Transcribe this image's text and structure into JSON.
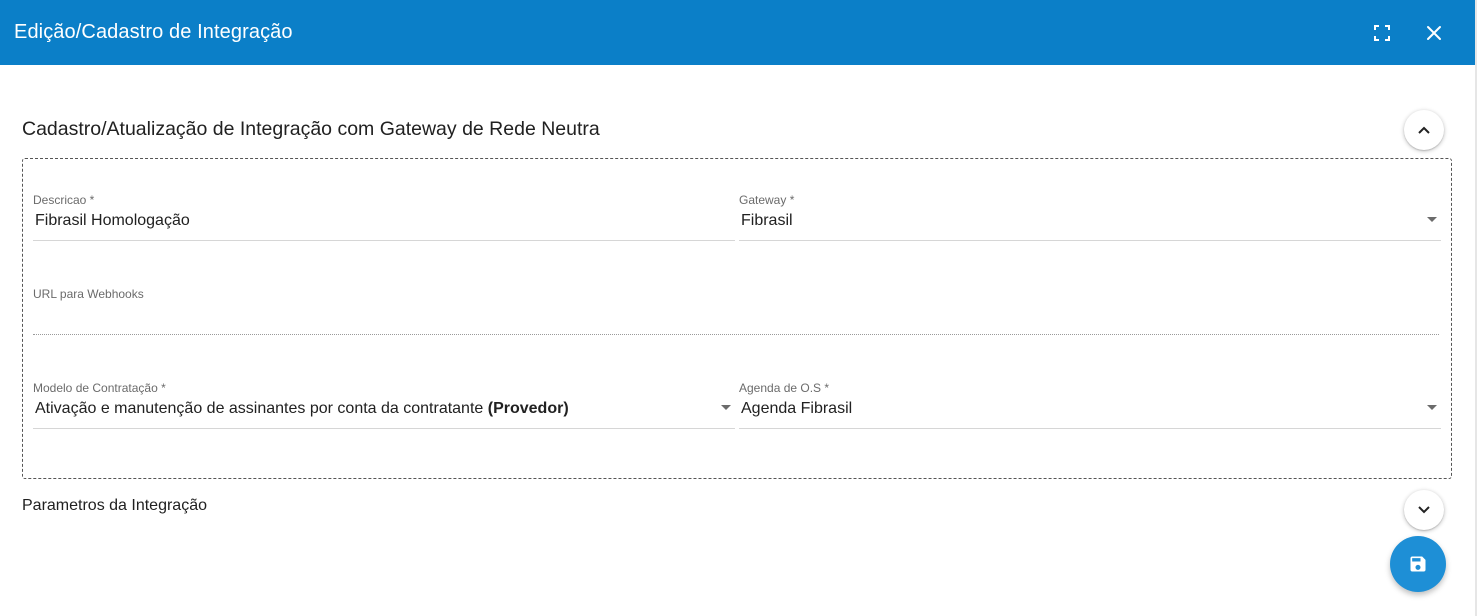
{
  "dialog": {
    "title": "Edição/Cadastro de Integração",
    "maximize_icon": "fullscreen-icon",
    "close_icon": "close-icon"
  },
  "section_main": {
    "title": "Cadastro/Atualização de Integração com Gateway de Rede Neutra",
    "toggle_icon": "chevron-up-icon"
  },
  "form": {
    "descricao": {
      "label": "Descricao *",
      "value": "Fibrasil Homologação"
    },
    "gateway": {
      "label": "Gateway *",
      "value": "Fibrasil"
    },
    "url_webhooks": {
      "label": "URL para Webhooks",
      "value": ""
    },
    "modelo_contratacao": {
      "label": "Modelo de Contratação *",
      "value_prefix": "Ativação e manutenção de assinantes por conta da contratante ",
      "value_bold": "(Provedor)"
    },
    "agenda_os": {
      "label": "Agenda de O.S *",
      "value": "Agenda Fibrasil"
    }
  },
  "section_params": {
    "title": "Parametros da Integração",
    "toggle_icon": "chevron-down-icon"
  },
  "actions": {
    "save_icon": "save-icon"
  },
  "colors": {
    "header_bg": "#0b7fc8",
    "fab_bg": "#1e8fd6"
  }
}
